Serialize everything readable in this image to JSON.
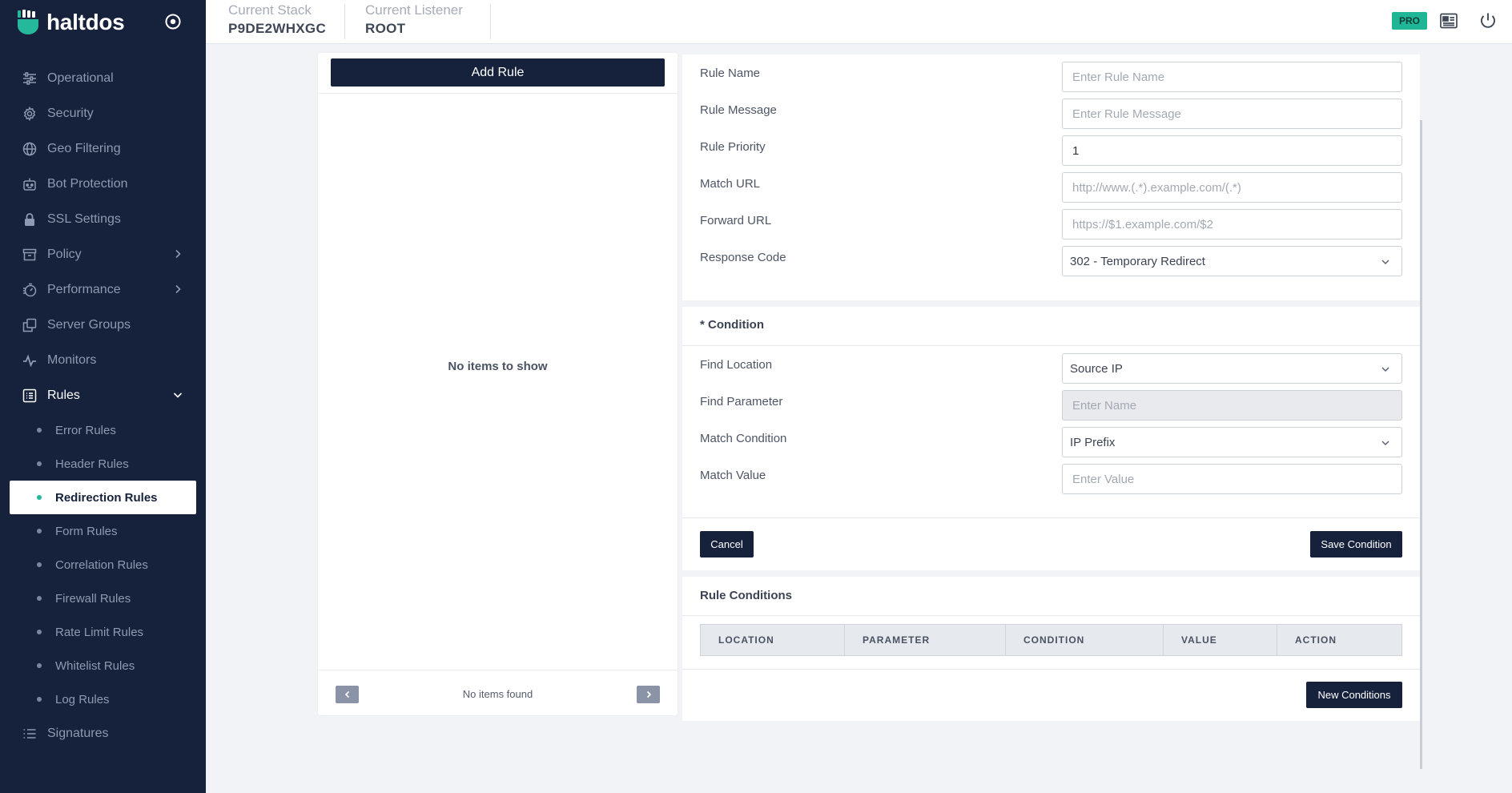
{
  "brand": {
    "name": "haltdos"
  },
  "header": {
    "stack_caption": "Current Stack",
    "stack_value": "P9DE2WHXGC",
    "listener_caption": "Current Listener",
    "listener_value": "ROOT",
    "badge": "PRO"
  },
  "sidebar": {
    "items": [
      {
        "label": "Operational",
        "icon": "sliders-icon"
      },
      {
        "label": "Security",
        "icon": "gear-icon"
      },
      {
        "label": "Geo Filtering",
        "icon": "globe-icon"
      },
      {
        "label": "Bot Protection",
        "icon": "bot-icon"
      },
      {
        "label": "SSL Settings",
        "icon": "lock-icon"
      },
      {
        "label": "Policy",
        "icon": "archive-icon"
      },
      {
        "label": "Performance",
        "icon": "gauge-icon"
      },
      {
        "label": "Server Groups",
        "icon": "copy-icon"
      },
      {
        "label": "Monitors",
        "icon": "pulse-icon"
      },
      {
        "label": "Rules",
        "icon": "list-box-icon"
      }
    ],
    "sub_items": [
      {
        "label": "Error Rules"
      },
      {
        "label": "Header Rules"
      },
      {
        "label": "Redirection Rules"
      },
      {
        "label": "Form Rules"
      },
      {
        "label": "Correlation Rules"
      },
      {
        "label": "Firewall Rules"
      },
      {
        "label": "Rate Limit Rules"
      },
      {
        "label": "Whitelist Rules"
      },
      {
        "label": "Log Rules"
      }
    ],
    "signatures": {
      "label": "Signatures",
      "icon": "list-icon"
    }
  },
  "rule_list": {
    "add_button": "Add Rule",
    "empty_text": "No items to show",
    "pagination_text": "No items found"
  },
  "rule_form": {
    "rule_name_label": "Rule Name",
    "rule_name_placeholder": "Enter Rule Name",
    "rule_message_label": "Rule Message",
    "rule_message_placeholder": "Enter Rule Message",
    "rule_priority_label": "Rule Priority",
    "rule_priority_value": "1",
    "match_url_label": "Match URL",
    "match_url_placeholder": "http://www.(.*).example.com/(.*)",
    "forward_url_label": "Forward URL",
    "forward_url_placeholder": "https://$1.example.com/$2",
    "response_code_label": "Response Code",
    "response_code_value": "302 - Temporary Redirect"
  },
  "condition": {
    "title": "* Condition",
    "find_location_label": "Find Location",
    "find_location_value": "Source IP",
    "find_parameter_label": "Find Parameter",
    "find_parameter_placeholder": "Enter Name",
    "match_condition_label": "Match Condition",
    "match_condition_value": "IP Prefix",
    "match_value_label": "Match Value",
    "match_value_placeholder": "Enter Value",
    "cancel_button": "Cancel",
    "save_button": "Save Condition"
  },
  "rule_conditions": {
    "title": "Rule Conditions",
    "columns": [
      "LOCATION",
      "PARAMETER",
      "CONDITION",
      "VALUE",
      "ACTION"
    ],
    "new_button": "New Conditions"
  }
}
